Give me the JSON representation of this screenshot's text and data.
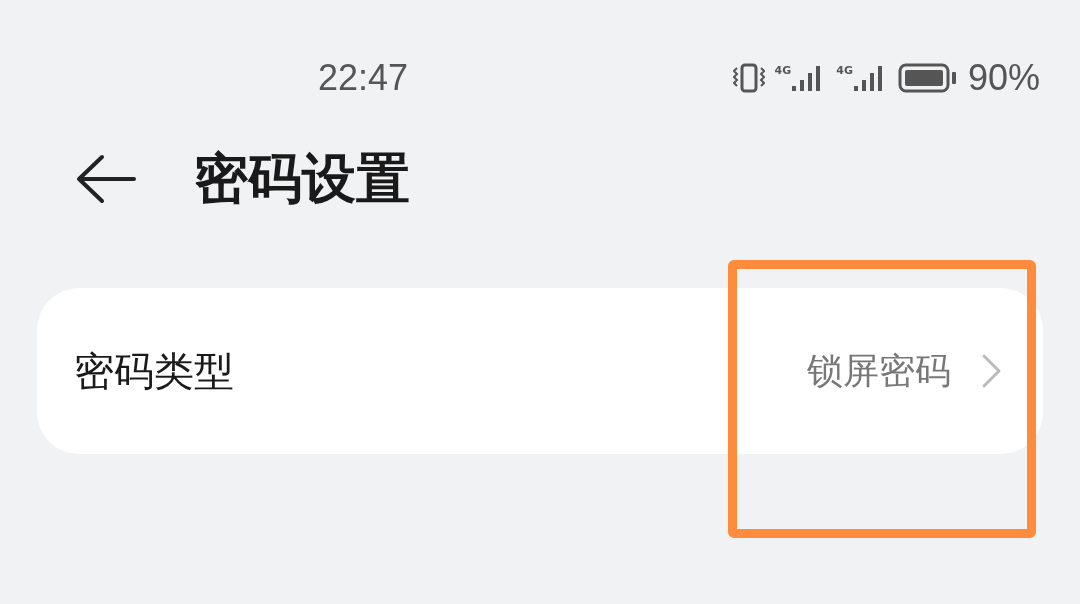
{
  "status_bar": {
    "time": "22:47",
    "signals": [
      {
        "label": "4G"
      },
      {
        "label": "4G"
      }
    ],
    "battery": "90%"
  },
  "header": {
    "title": "密码设置"
  },
  "settings": [
    {
      "label": "密码类型",
      "value": "锁屏密码"
    }
  ]
}
